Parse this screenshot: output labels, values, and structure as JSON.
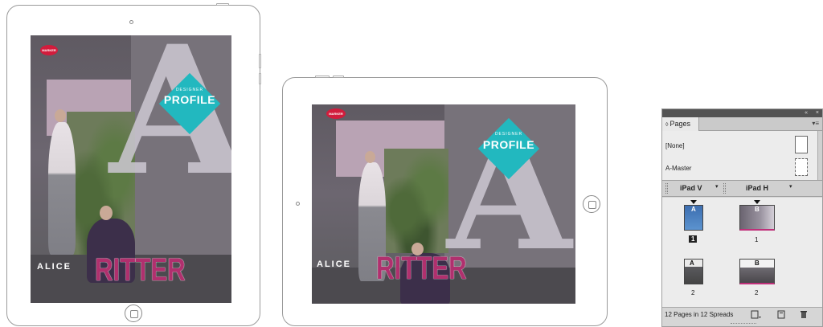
{
  "cover": {
    "big_letter": "A",
    "badge_top": "DESIGNER",
    "badge_main": "PROFILE",
    "logo_text": "MARKER",
    "first_name": "ALICE",
    "last_name": "RITTER"
  },
  "panel": {
    "tab_icon": "◊",
    "tab_label": "Pages",
    "collapse_glyph": "«",
    "close_glyph": "×",
    "menu_glyph": "▾≡",
    "masters": [
      {
        "label": "[None]"
      },
      {
        "label": "A-Master"
      }
    ],
    "layouts": [
      {
        "label": "iPad V",
        "caret": "▾"
      },
      {
        "label": "iPad H",
        "caret": "▾"
      }
    ],
    "pages": {
      "row1": {
        "v_num": "1",
        "h_num": "1",
        "v_master": "A",
        "h_master": "B"
      },
      "row2": {
        "v_num": "2",
        "h_num": "2",
        "v_master": "A",
        "h_master": "B"
      }
    },
    "status": "12 Pages in 12 Spreads",
    "icons": [
      "edit-page-size-icon",
      "new-page-icon",
      "delete-page-icon"
    ]
  },
  "colors": {
    "badge": "#22b8bf",
    "last_name": "#b0306e",
    "logo": "#d21c3c"
  }
}
